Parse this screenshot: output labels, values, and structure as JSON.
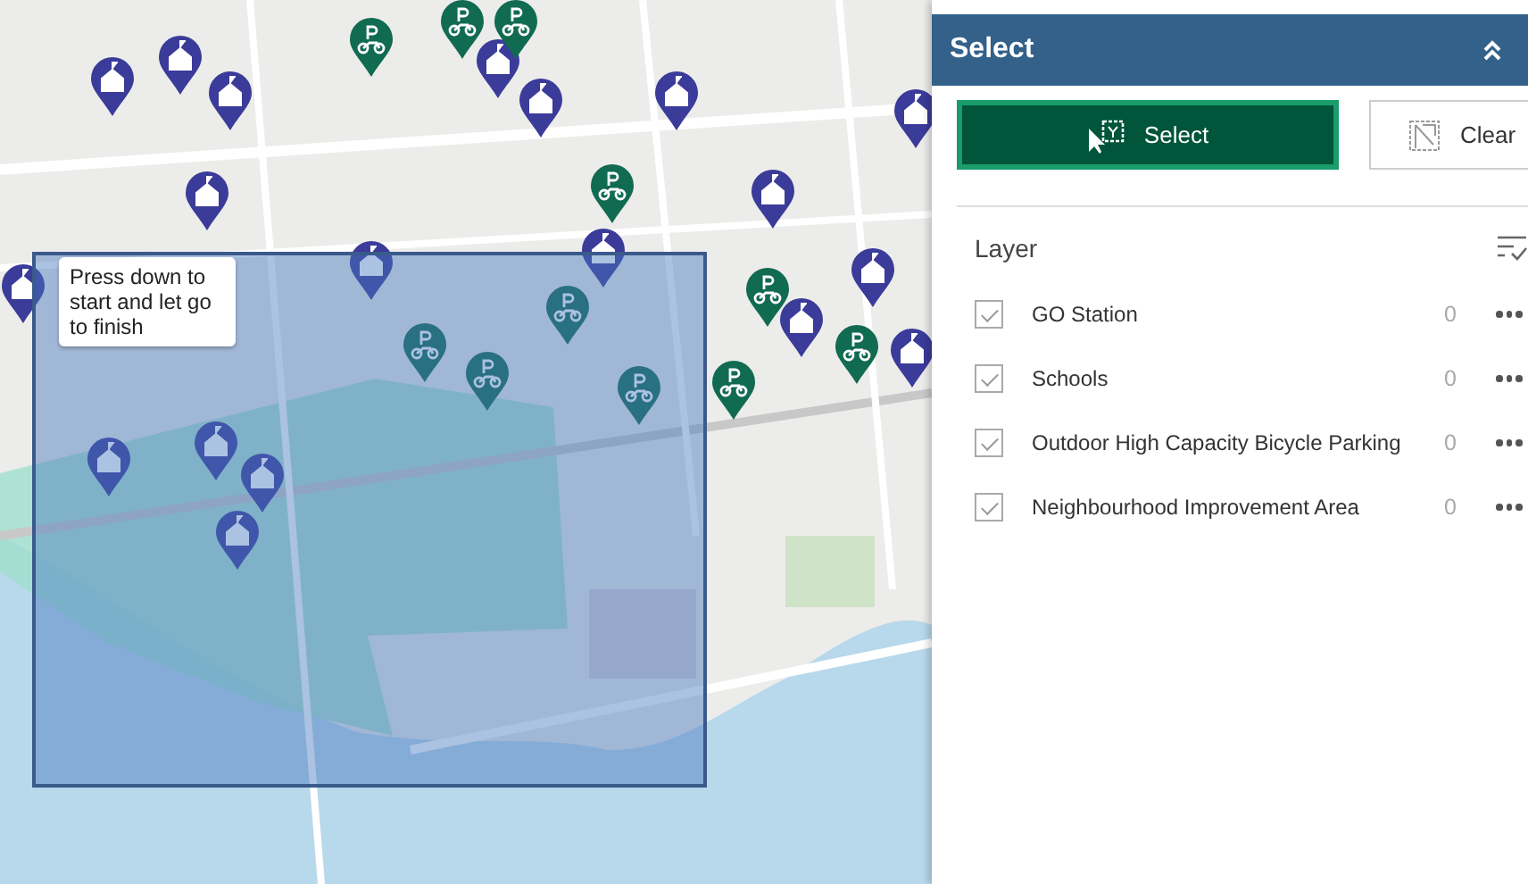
{
  "map": {
    "tooltip": "Press down to start and let go to finish"
  },
  "panel": {
    "title": "Select",
    "expanded": true,
    "buttons": [
      {
        "label": "Select",
        "kind": "select",
        "selected": true
      },
      {
        "label": "Clear",
        "kind": "clear",
        "selected": false
      }
    ],
    "layer_header": "Layer",
    "layers": [
      {
        "name": "GO Station",
        "checked": true,
        "count": "0"
      },
      {
        "name": "Schools",
        "checked": true,
        "count": "0"
      },
      {
        "name": "Outdoor High Capacity Bicycle Parking",
        "checked": true,
        "count": "0"
      },
      {
        "name": "Neighbourhood Improvement Area",
        "checked": true,
        "count": "0"
      }
    ]
  }
}
